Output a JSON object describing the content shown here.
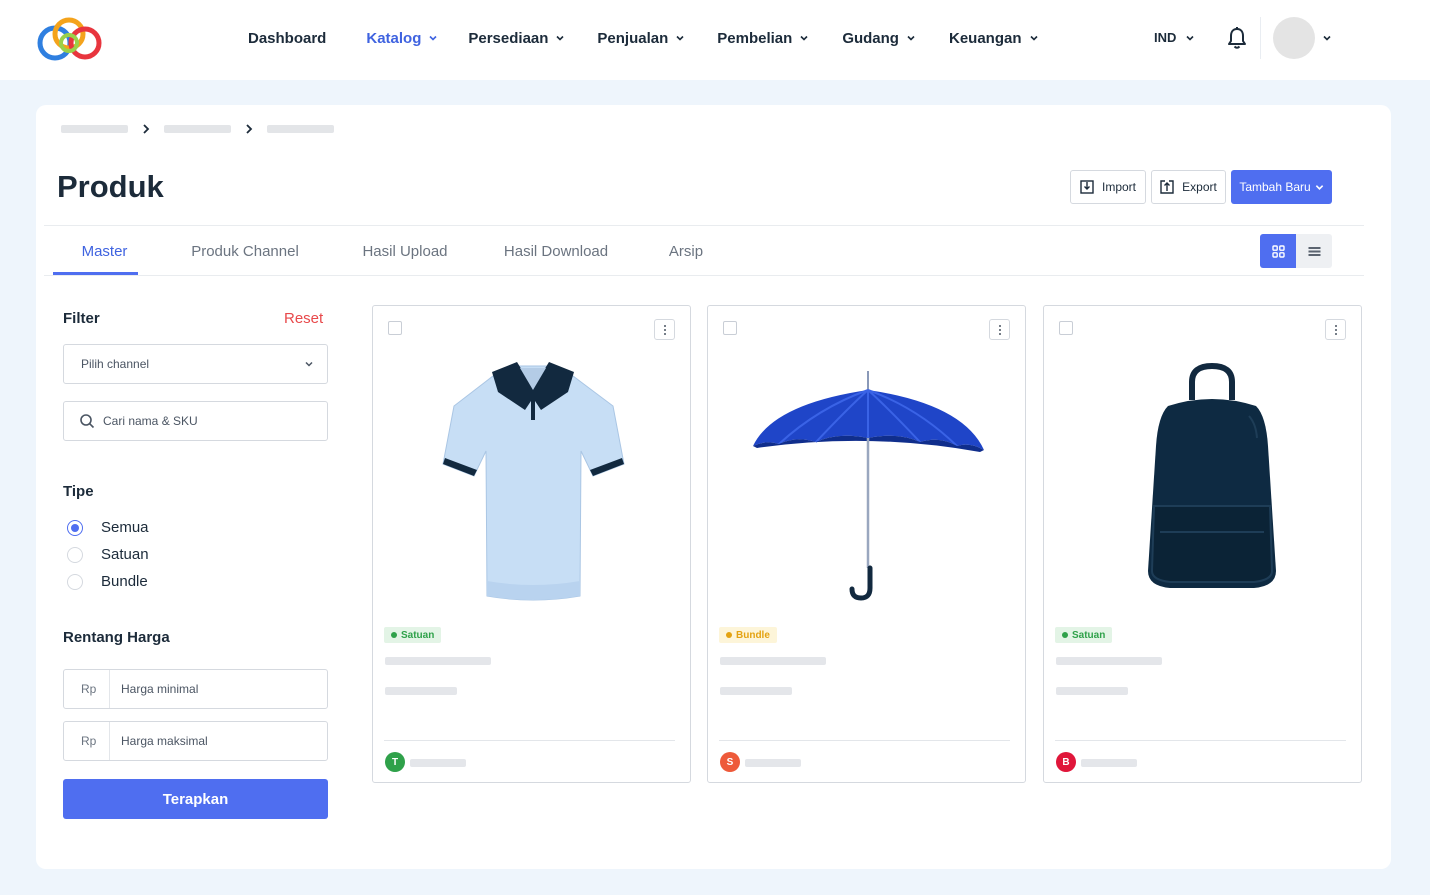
{
  "nav": {
    "items": [
      {
        "label": "Dashboard",
        "has_dropdown": false,
        "active": false
      },
      {
        "label": "Katalog",
        "has_dropdown": true,
        "active": true
      },
      {
        "label": "Persediaan",
        "has_dropdown": true,
        "active": false
      },
      {
        "label": "Penjualan",
        "has_dropdown": true,
        "active": false
      },
      {
        "label": "Pembelian",
        "has_dropdown": true,
        "active": false
      },
      {
        "label": "Gudang",
        "has_dropdown": true,
        "active": false
      },
      {
        "label": "Keuangan",
        "has_dropdown": true,
        "active": false
      }
    ],
    "language": "IND"
  },
  "page": {
    "title": "Produk",
    "actions": {
      "import_label": "Import",
      "export_label": "Export",
      "add_label": "Tambah Baru"
    }
  },
  "tabs": [
    {
      "label": "Master",
      "active": true
    },
    {
      "label": "Produk Channel",
      "active": false
    },
    {
      "label": "Hasil Upload",
      "active": false
    },
    {
      "label": "Hasil Download",
      "active": false
    },
    {
      "label": "Arsip",
      "active": false
    }
  ],
  "view_mode": "grid",
  "filter": {
    "title": "Filter",
    "reset_label": "Reset",
    "channel_placeholder": "Pilih channel",
    "search_placeholder": "Cari nama & SKU",
    "type_title": "Tipe",
    "type_options": [
      {
        "label": "Semua",
        "selected": true
      },
      {
        "label": "Satuan",
        "selected": false
      },
      {
        "label": "Bundle",
        "selected": false
      }
    ],
    "price_title": "Rentang Harga",
    "currency": "Rp",
    "min_placeholder": "Harga minimal",
    "max_placeholder": "Harga maksimal",
    "apply_label": "Terapkan"
  },
  "products": [
    {
      "image": "polo-shirt",
      "type": "Satuan",
      "type_color": "#2fa14a",
      "channel_initial": "T",
      "channel_color": "#2fa14a"
    },
    {
      "image": "umbrella",
      "type": "Bundle",
      "type_color": "#e4a312",
      "channel_initial": "S",
      "channel_color": "#ee5a3a"
    },
    {
      "image": "backpack",
      "type": "Satuan",
      "type_color": "#2fa14a",
      "channel_initial": "B",
      "channel_color": "#e0163a"
    }
  ],
  "colors": {
    "accent": "#4f6ef0",
    "reset": "#e8494b",
    "background": "#eef5fc"
  }
}
